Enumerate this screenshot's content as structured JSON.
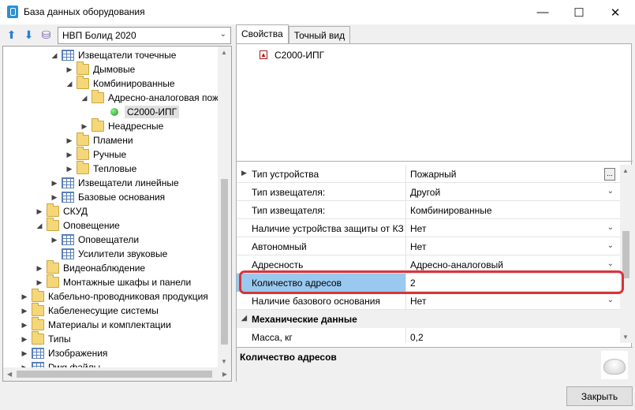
{
  "window": {
    "title": "База данных оборудования",
    "minimize": "—",
    "maximize": "☐",
    "close": "✕"
  },
  "toolbar": {
    "up_icon": "arrow-up-icon",
    "down_icon": "arrow-down-icon",
    "db_icon": "database-icon",
    "database_selected": "НВП Болид 2020"
  },
  "tree": {
    "items": [
      {
        "label": "Извещатели точечные",
        "icon": "table",
        "expander": "◢"
      },
      {
        "label": "Дымовые",
        "icon": "folder",
        "expander": "▶"
      },
      {
        "label": "Комбинированные",
        "icon": "folder-open",
        "expander": "◢"
      },
      {
        "label": "Адресно-аналоговая пож",
        "icon": "folder-open",
        "expander": "◢"
      },
      {
        "label": "С2000-ИПГ",
        "icon": "dot",
        "expander": ""
      },
      {
        "label": "Неадресные",
        "icon": "folder",
        "expander": "▶"
      },
      {
        "label": "Пламени",
        "icon": "folder",
        "expander": "▶"
      },
      {
        "label": "Ручные",
        "icon": "folder",
        "expander": "▶"
      },
      {
        "label": "Тепловые",
        "icon": "folder",
        "expander": "▶"
      },
      {
        "label": "Извещатели линейные",
        "icon": "table",
        "expander": "▶"
      },
      {
        "label": "Базовые основания",
        "icon": "table",
        "expander": "▶"
      },
      {
        "label": "СКУД",
        "icon": "folder",
        "expander": "▶"
      },
      {
        "label": "Оповещение",
        "icon": "folder-open",
        "expander": "◢"
      },
      {
        "label": "Оповещатели",
        "icon": "table",
        "expander": "▶"
      },
      {
        "label": "Усилители звуковые",
        "icon": "table",
        "expander": ""
      },
      {
        "label": "Видеонаблюдение",
        "icon": "folder",
        "expander": "▶"
      },
      {
        "label": "Монтажные шкафы и панели",
        "icon": "folder",
        "expander": "▶"
      },
      {
        "label": "Кабельно-проводниковая продукция",
        "icon": "folder",
        "expander": "▶"
      },
      {
        "label": "Кабеленесущие системы",
        "icon": "folder",
        "expander": "▶"
      },
      {
        "label": "Материалы и комплектации",
        "icon": "folder",
        "expander": "▶"
      },
      {
        "label": "Типы",
        "icon": "folder",
        "expander": "▶"
      },
      {
        "label": "Изображения",
        "icon": "table",
        "expander": "▶"
      },
      {
        "label": "Dwg файлы",
        "icon": "table",
        "expander": "▶"
      }
    ]
  },
  "tabs": [
    {
      "label": "Свойства"
    },
    {
      "label": "Точный вид"
    }
  ],
  "preview": {
    "device_name": "С2000-ИПГ"
  },
  "properties": {
    "rows": [
      {
        "label": "Тип устройства",
        "value": "Пожарный",
        "control": "ellipsis",
        "expander": "▶"
      },
      {
        "label": "Тип извещателя:",
        "value": "Другой",
        "control": "dropdown"
      },
      {
        "label": "Тип извещателя:",
        "value": "Комбинированные",
        "control": ""
      },
      {
        "label": "Наличие устройства защиты от КЗ",
        "value": "Нет",
        "control": "dropdown"
      },
      {
        "label": "Автономный",
        "value": "Нет",
        "control": "dropdown"
      },
      {
        "label": "Адресность",
        "value": "Адресно-аналоговый",
        "control": "dropdown"
      },
      {
        "label": "Количество адресов",
        "value": "2",
        "control": "",
        "selected": true
      },
      {
        "label": "Наличие базового основания",
        "value": "Нет",
        "control": "dropdown"
      },
      {
        "label": "Механические данные",
        "value": "",
        "control": "",
        "category": true,
        "expander": "◢"
      },
      {
        "label": "Масса, кг",
        "value": "0,2",
        "control": ""
      }
    ]
  },
  "description": {
    "title": "Количество адресов"
  },
  "footer": {
    "close_label": "Закрыть"
  }
}
